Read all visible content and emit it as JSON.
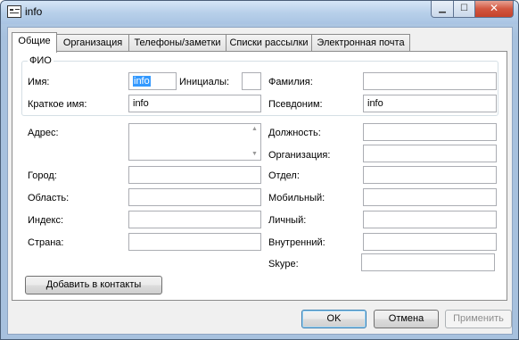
{
  "window": {
    "title": "info",
    "minimize": "▁",
    "maximize": "☐",
    "close": "✕"
  },
  "tabs": [
    {
      "label": "Общие"
    },
    {
      "label": "Организация"
    },
    {
      "label": "Телефоны/заметки"
    },
    {
      "label": "Списки рассылки"
    },
    {
      "label": "Электронная почта"
    }
  ],
  "fio": {
    "legend": "ФИО",
    "first_name_label": "Имя:",
    "first_name_value": "info",
    "initials_label": "Инициалы:",
    "initials_value": "",
    "last_name_label": "Фамилия:",
    "last_name_value": "",
    "short_name_label": "Краткое имя:",
    "short_name_value": "info",
    "nickname_label": "Псевдоним:",
    "nickname_value": "info"
  },
  "address": {
    "address_label": "Адрес:",
    "address_value": "",
    "city_label": "Город:",
    "city_value": "",
    "region_label": "Область:",
    "region_value": "",
    "zip_label": "Индекс:",
    "zip_value": "",
    "country_label": "Страна:",
    "country_value": ""
  },
  "work": {
    "position_label": "Должность:",
    "position_value": "",
    "organization_label": "Организация:",
    "organization_value": "",
    "department_label": "Отдел:",
    "department_value": "",
    "mobile_label": "Мобильный:",
    "mobile_value": "",
    "personal_label": "Личный:",
    "personal_value": "",
    "internal_label": "Внутренний:",
    "internal_value": "",
    "skype_label": "Skype:",
    "skype_value": ""
  },
  "buttons": {
    "add_contacts": "Добавить в контакты",
    "ok": "OK",
    "cancel": "Отмена",
    "apply": "Применить"
  },
  "icons": {
    "scroll_up": "▲",
    "scroll_down": "▼"
  }
}
